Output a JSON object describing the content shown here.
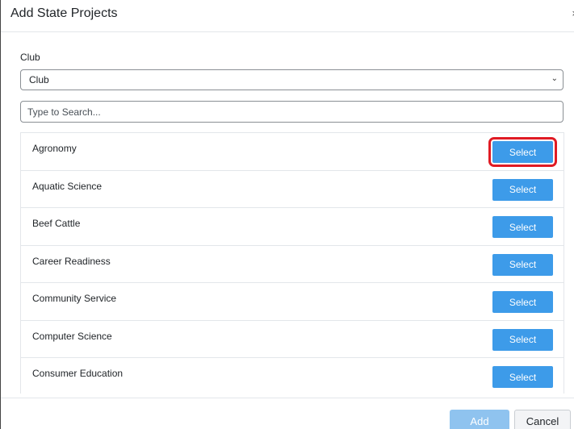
{
  "modal": {
    "title": "Add State Projects",
    "close_glyph": "×"
  },
  "filter": {
    "label": "Club",
    "selected": "Club",
    "chevron": "⌄"
  },
  "search": {
    "placeholder": "Type to Search..."
  },
  "projects": [
    {
      "name": "Agronomy",
      "button": "Select"
    },
    {
      "name": "Aquatic Science",
      "button": "Select"
    },
    {
      "name": "Beef Cattle",
      "button": "Select"
    },
    {
      "name": "Career Readiness",
      "button": "Select"
    },
    {
      "name": "Community Service",
      "button": "Select"
    },
    {
      "name": "Computer Science",
      "button": "Select"
    },
    {
      "name": "Consumer Education",
      "button": "Select"
    }
  ],
  "footer": {
    "add_label": "Add",
    "cancel_label": "Cancel"
  },
  "colors": {
    "primary": "#3d9be9",
    "primary_disabled": "#8fc3ef",
    "highlight": "#e01b24"
  },
  "icons": {
    "close": "close-icon",
    "dropdown": "chevron-down-icon"
  }
}
